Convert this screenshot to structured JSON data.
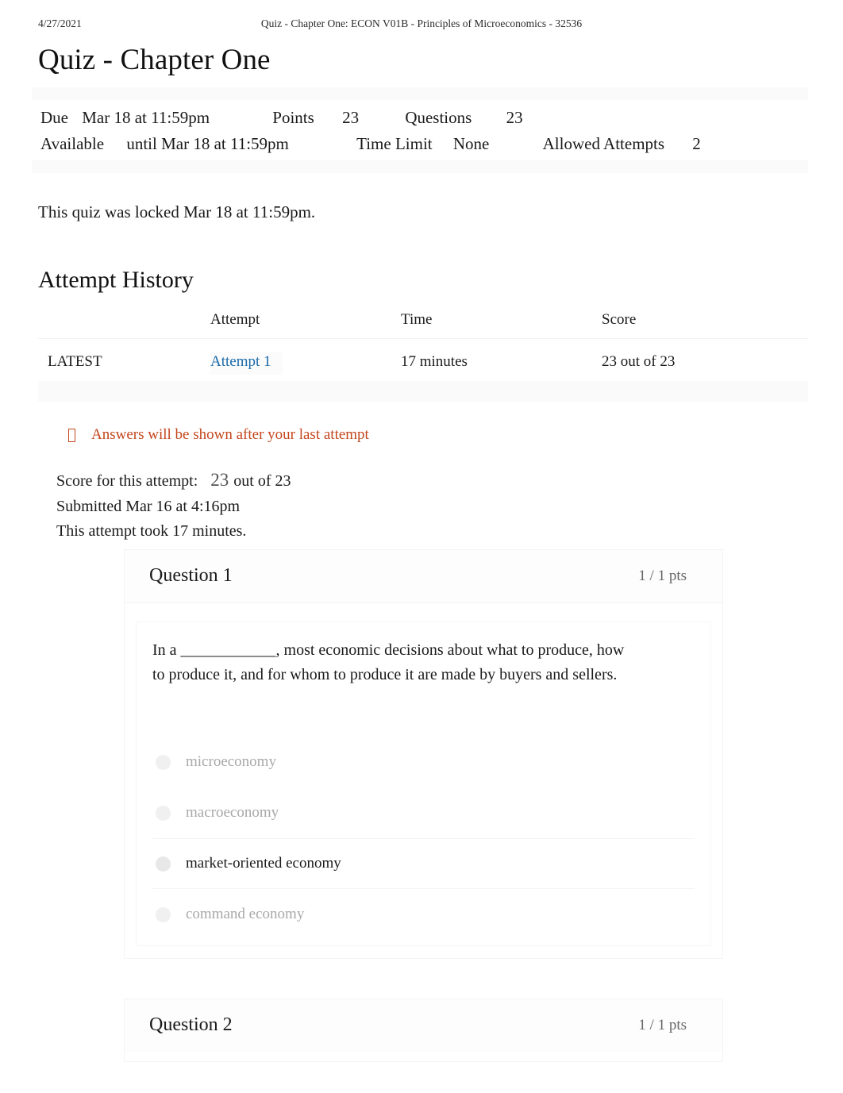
{
  "print_header": {
    "date": "4/27/2021",
    "title": "Quiz - Chapter One: ECON V01B - Principles of Microeconomics - 32536"
  },
  "page_title": "Quiz - Chapter One",
  "quiz_details": {
    "due_label": "Due",
    "due_value": "Mar 18 at 11:59pm",
    "points_label": "Points",
    "points_value": "23",
    "questions_label": "Questions",
    "questions_value": "23",
    "available_label": "Available",
    "available_value": "until Mar 18 at 11:59pm",
    "time_limit_label": "Time Limit",
    "time_limit_value": "None",
    "allowed_attempts_label": "Allowed Attempts",
    "allowed_attempts_value": "2"
  },
  "locked_notice": "This quiz was locked Mar 18 at 11:59pm.",
  "attempt_history": {
    "section_title": "Attempt History",
    "columns": [
      "",
      "Attempt",
      "Time",
      "Score"
    ],
    "rows": [
      {
        "kept": "LATEST",
        "attempt": "Attempt 1",
        "time": "17 minutes",
        "score": "23 out of 23"
      }
    ]
  },
  "answers_notice": {
    "icon": "warning-icon",
    "text": "Answers will be shown after your last attempt"
  },
  "attempt_summary": {
    "score_label": "Score for this attempt:",
    "score_value": "23",
    "score_out_of": "out of 23",
    "submitted": "Submitted Mar 16 at 4:16pm",
    "duration": "This attempt took 17 minutes."
  },
  "questions": [
    {
      "title": "Question 1",
      "points": "1 / 1 pts",
      "text": "In a ____________, most economic decisions about what to produce, how to produce it, and for whom to produce it are made by buyers and sellers.",
      "answers": [
        {
          "label": "microeconomy",
          "selected": false
        },
        {
          "label": "macroeconomy",
          "selected": false
        },
        {
          "label": "market-oriented economy",
          "selected": true
        },
        {
          "label": "command economy",
          "selected": false
        }
      ]
    },
    {
      "title": "Question 2",
      "points": "1 / 1 pts",
      "text": "",
      "answers": []
    }
  ],
  "colors": {
    "link": "#1a6aa8",
    "notice": "#c4461c",
    "muted": "#a8a8a8",
    "points": "#666666"
  }
}
